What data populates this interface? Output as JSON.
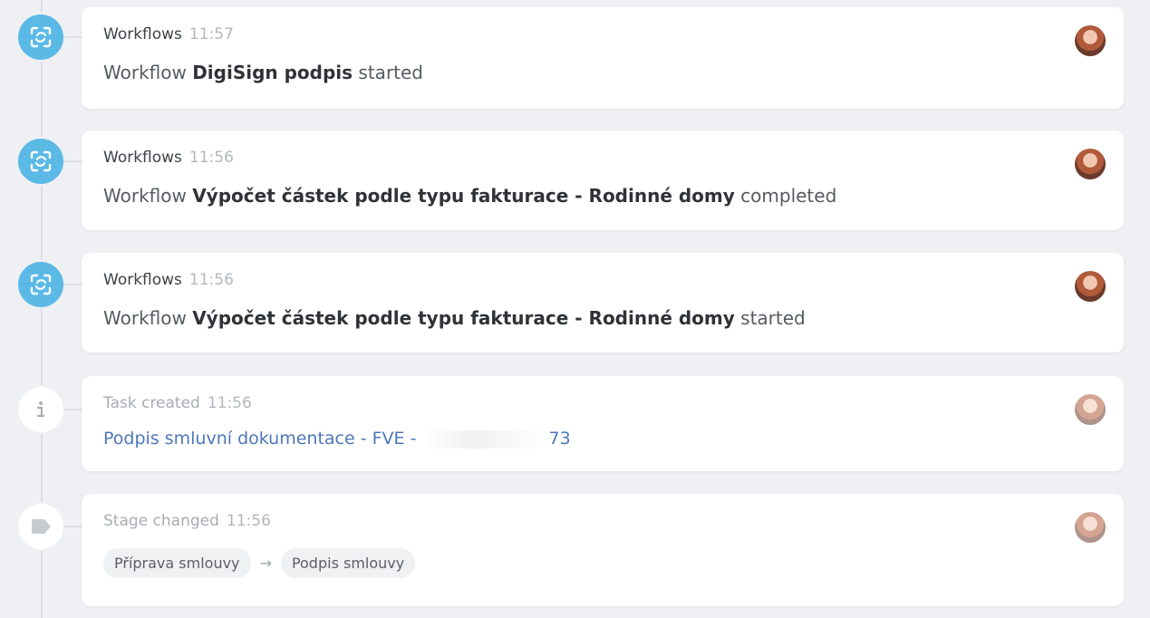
{
  "feed": {
    "items": [
      {
        "type": "workflow",
        "icon": "workflow-sync-icon",
        "source": "Workflows",
        "time": "11:57",
        "prefix": "Workflow",
        "name": "DigiSign podpis",
        "status": "started"
      },
      {
        "type": "workflow",
        "icon": "workflow-sync-icon",
        "source": "Workflows",
        "time": "11:56",
        "prefix": "Workflow",
        "name": "Výpočet částek podle typu fakturace - Rodinné domy",
        "status": "completed"
      },
      {
        "type": "workflow",
        "icon": "workflow-sync-icon",
        "source": "Workflows",
        "time": "11:56",
        "prefix": "Workflow",
        "name": "Výpočet částek podle typu fakturace - Rodinné domy",
        "status": "started"
      },
      {
        "type": "task",
        "icon": "info-icon",
        "source": "Task created",
        "time": "11:56",
        "link_start": "Podpis smluvní dokumentace - FVE -",
        "link_end": "73"
      },
      {
        "type": "stage",
        "icon": "tag-icon",
        "source": "Stage changed",
        "time": "11:56",
        "from_stage": "Příprava smlouvy",
        "arrow": "→",
        "to_stage": "Podpis smlouvy"
      }
    ]
  },
  "colors": {
    "page_background": "#eef0f3",
    "card_background": "#ffffff",
    "workflow_icon": "#5bb9e6",
    "link": "#4d77b8",
    "timeline": "#dcdfe4"
  }
}
